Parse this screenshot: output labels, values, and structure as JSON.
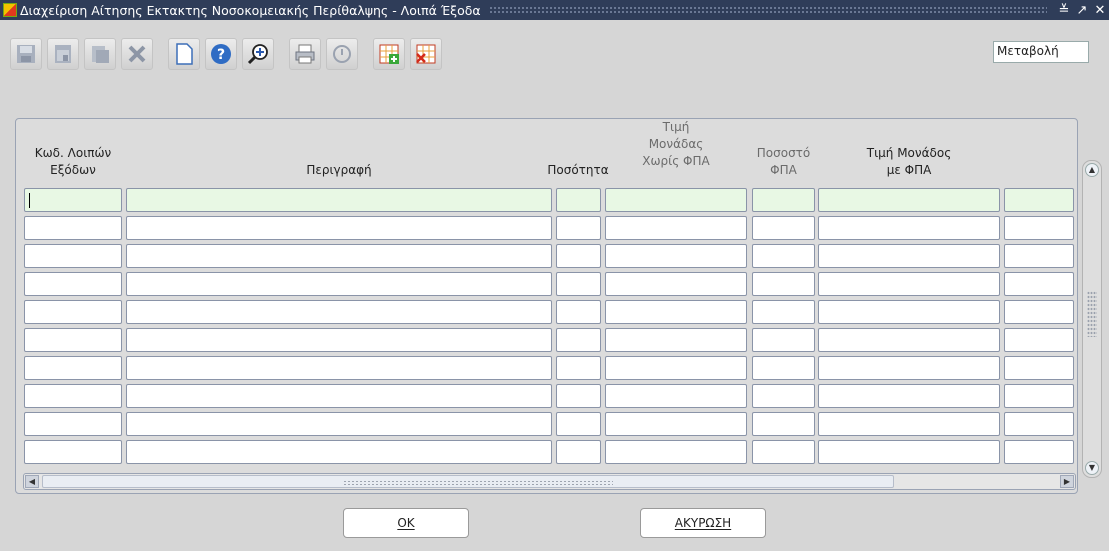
{
  "window": {
    "title": "Διαχείριση Αίτησης Εκτακτης Νοσοκομειακής Περίθαλψης - Λοιπά Έξοδα",
    "controls": [
      "≚",
      "↗",
      "✕"
    ]
  },
  "toolbar": {
    "buttons": [
      "save-icon",
      "print-preview-icon",
      "clear-record-icon",
      "delete-icon",
      "new-document-icon",
      "help-icon",
      "zoom-icon",
      "print-icon",
      "exit-icon",
      "insert-row-icon",
      "delete-row-icon"
    ]
  },
  "mode": {
    "value": "Μεταβολή"
  },
  "grid": {
    "headers": {
      "code_line1": "Κωδ. Λοιπών",
      "code_line2": "Εξόδων",
      "description": "Περιγραφή",
      "quantity": "Ποσότητα",
      "unit_price_line1": "Τιμή",
      "unit_price_line2": "Μονάδας",
      "unit_price_line3": "Χωρίς ΦΠΑ",
      "vat_line1": "Ποσοστό",
      "vat_line2": "ΦΠΑ",
      "price_vat_line1": "Τιμή Μονάδος",
      "price_vat_line2": "με ΦΠΑ"
    },
    "row_count": 10,
    "rows": []
  },
  "buttons": {
    "ok": "OK",
    "cancel": "ΑΚΥΡΩΣΗ"
  }
}
